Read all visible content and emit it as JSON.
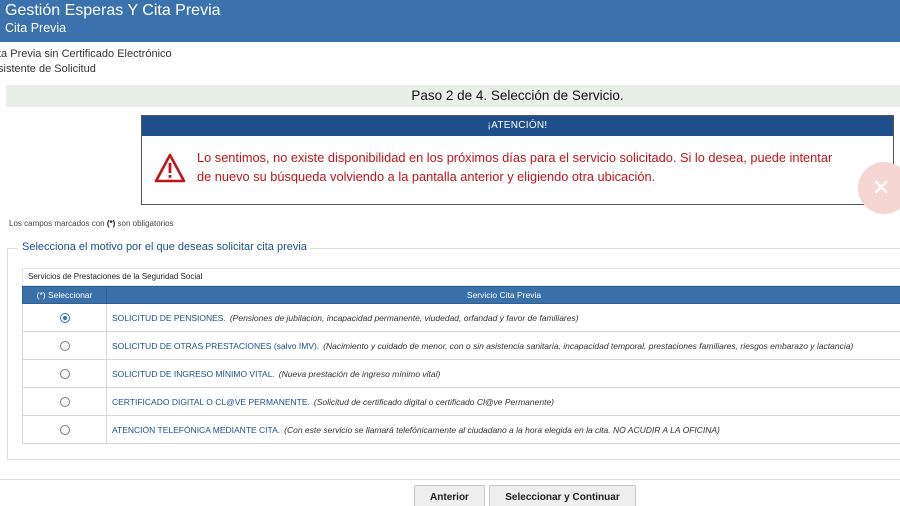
{
  "header": {
    "title": "Gestión Esperas Y Cita Previa",
    "subtitle": "Cita Previa"
  },
  "breadcrumbs": [
    "ta Previa sin Certificado Electrónico",
    "sistente de Solicitud"
  ],
  "step": {
    "label": "Paso 2 de 4. Selección de Servicio."
  },
  "alert": {
    "heading": "¡ATENCIÓN!",
    "message": "Lo sentimos, no existe disponibilidad en los próximos días para el servicio solicitado. Si lo desea, puede intentar de nuevo su búsqueda volviendo a la pantalla anterior y eligiendo otra ubicación.",
    "icon": "warning-triangle-icon",
    "color": "#c0141b"
  },
  "close_button": {
    "glyph": "✕"
  },
  "mandatory_note": {
    "before": "Los campos marcados con ",
    "marker": "(*)",
    "after": " son obligatorios"
  },
  "form": {
    "legend": "Selecciona el motivo por el que deseas solicitar cita previa",
    "group": "Servicios de Prestaciones de la Seguridad Social",
    "columns": {
      "select": "(*) Seleccionar",
      "service": "Servicio Cita Previa"
    },
    "services": [
      {
        "name": "SOLICITUD DE PENSIONES.",
        "note": "(Pensiones de jubilacion, incapacidad permanente, viudedad, orfandad y favor de familiares)",
        "selected": true
      },
      {
        "name": "SOLICITUD DE OTRAS PRESTACIONES (salvo IMV).",
        "note": "(Nacimiento y cuidado de menor, con o sin asistencia sanitaria, incapacidad temporal, prestaciones familiares, riesgos embarazo y lactancia)",
        "selected": false
      },
      {
        "name": "SOLICITUD DE INGRESO MÍNIMO VITAL.",
        "note": "(Nueva prestación de ingreso mínimo vital)",
        "selected": false
      },
      {
        "name": "CERTIFICADO DIGITAL O CL@VE PERMANENTE.",
        "note": "(Solicitud de certificado digital o certificado Cl@ve Permanente)",
        "selected": false
      },
      {
        "name": "ATENCIÓN TELEFÓNICA MEDIANTE CITA.",
        "note": "(Con este servicio se llamará telefónicamente al ciudadano a la hora elegida en la cita. NO ACUDIR A LA OFICINA)",
        "selected": false
      }
    ]
  },
  "buttons": {
    "previous": "Anterior",
    "next": "Seleccionar y Continuar"
  },
  "colors": {
    "header_bg": "#3b72ad",
    "alert_header_bg": "#1f4f8a",
    "table_header_bg": "#3a70a8",
    "step_bg": "#e8efe6"
  }
}
